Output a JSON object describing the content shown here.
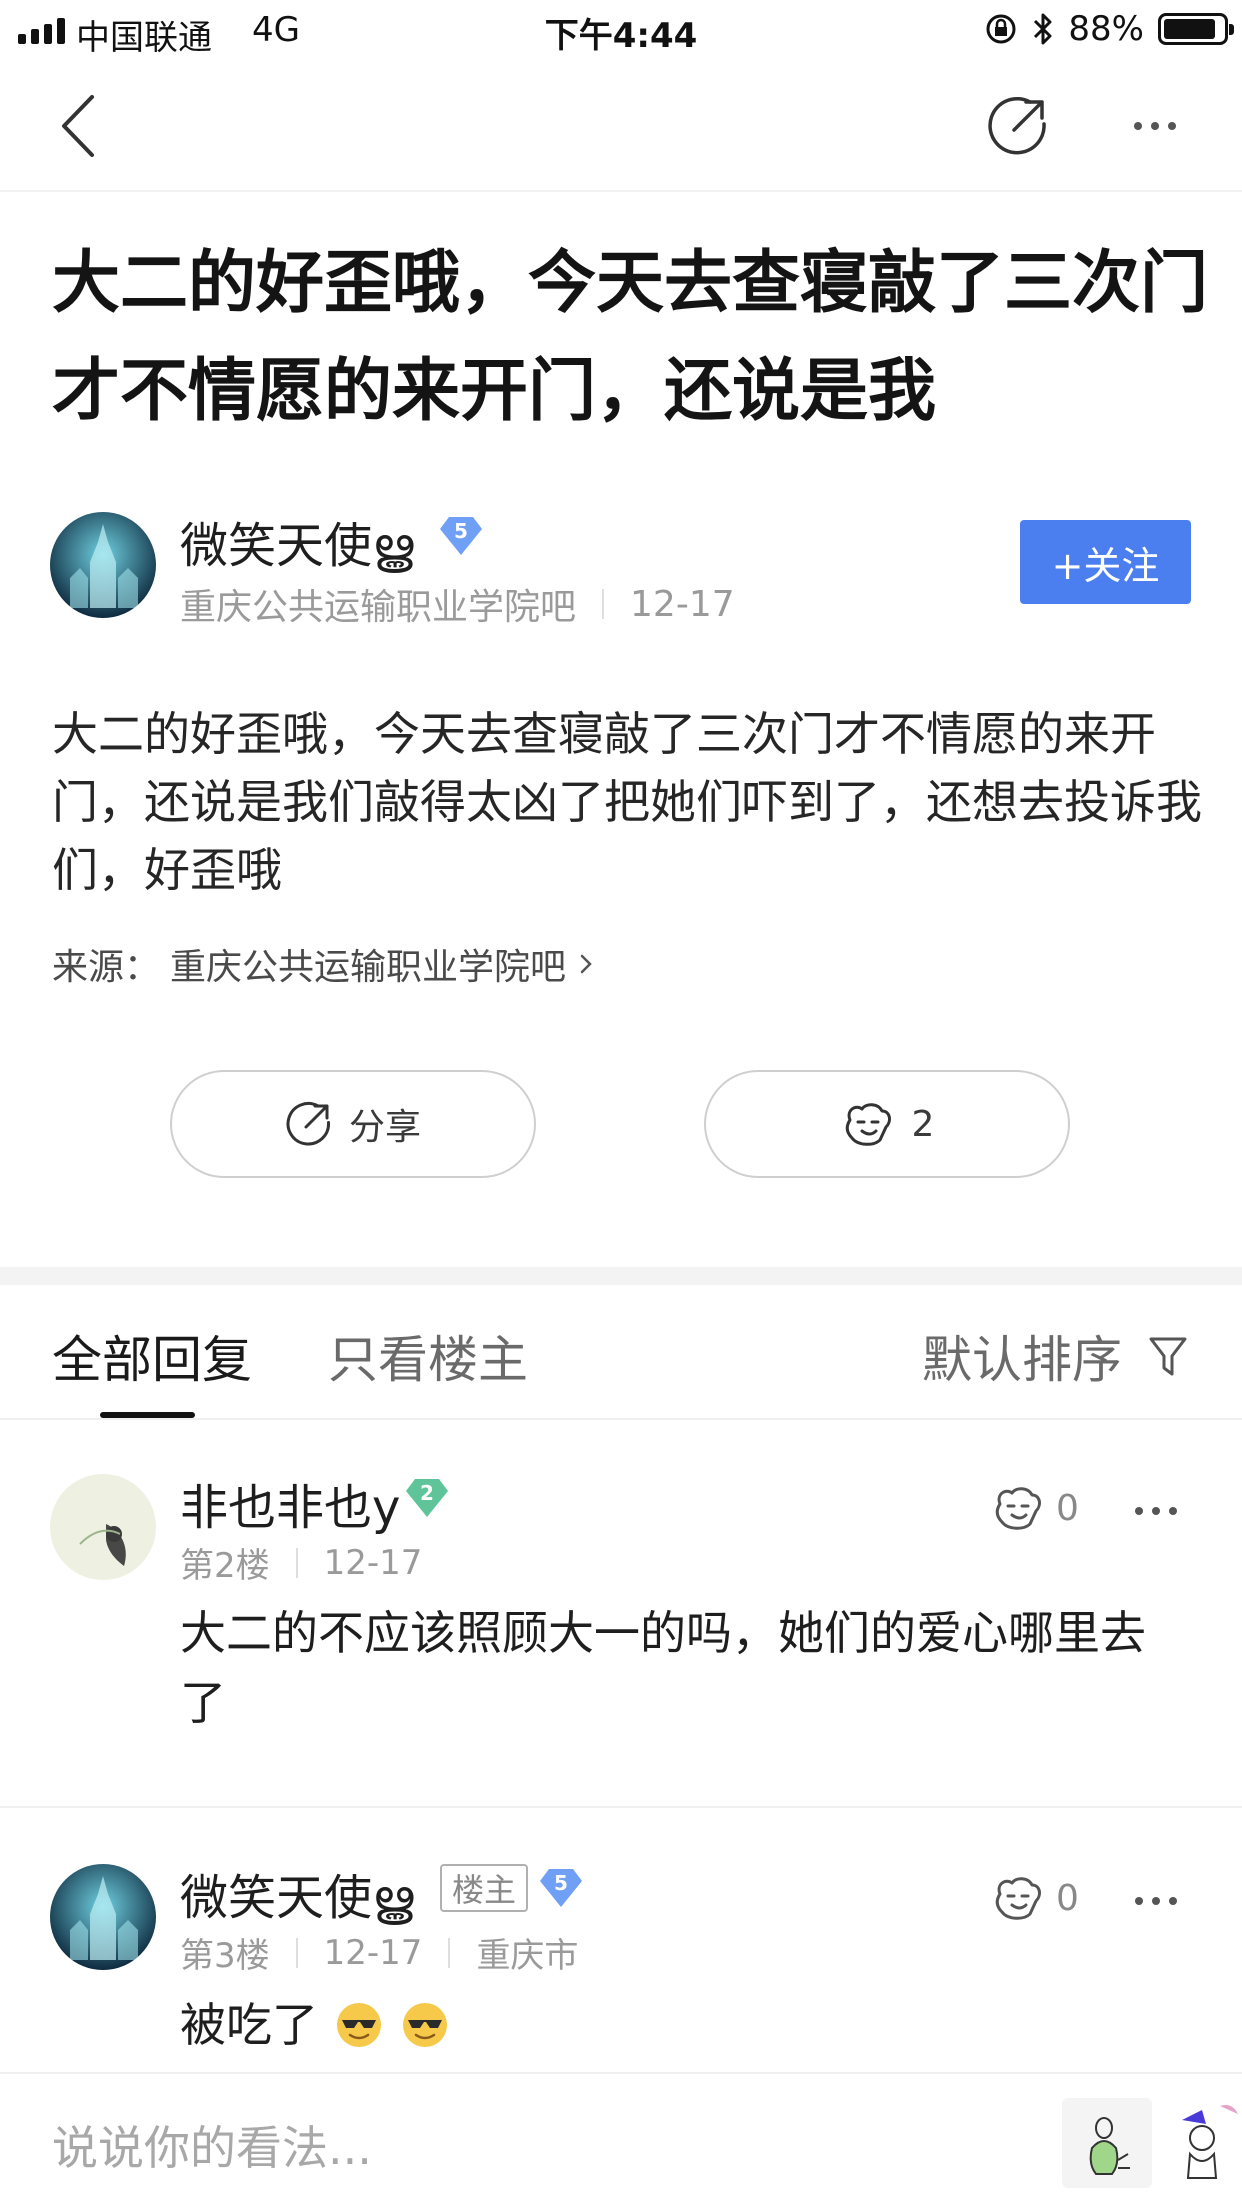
{
  "status_bar": {
    "carrier": "中国联通",
    "network": "4G",
    "time": "下午4:44",
    "battery": "88%"
  },
  "post": {
    "title": "大二的好歪哦，今天去查寝敲了三次门才不情愿的来开门，还说是我",
    "author": {
      "name": "微笑天使ൠ",
      "level": "5",
      "forum": "重庆公共运输职业学院吧",
      "date": "12-17"
    },
    "follow_label": "+关注",
    "body": "大二的好歪哦，今天去查寝敲了三次门才不情愿的来开门，还说是我们敲得太凶了把她们吓到了，还想去投诉我们，好歪哦",
    "source_label": "来源：",
    "source_forum": "重庆公共运输职业学院吧",
    "share_label": "分享",
    "like_count": "2"
  },
  "tabs": {
    "all_replies": "全部回复",
    "owner_only": "只看楼主",
    "sort": "默认排序"
  },
  "replies": [
    {
      "name": "非也非也y",
      "level": "2",
      "floor": "第2楼",
      "date": "12-17",
      "likes": "0",
      "text": "大二的不应该照顾大一的吗，她们的爱心哪里去了"
    },
    {
      "name": "微笑天使ൠ",
      "owner_tag": "楼主",
      "level": "5",
      "floor": "第3楼",
      "date": "12-17",
      "location": "重庆市",
      "likes": "0",
      "text": "被吃了"
    }
  ],
  "composer": {
    "placeholder": "说说你的看法..."
  },
  "colors": {
    "accent": "#4b7ff0",
    "level_blue": "#6fa0f5",
    "level_green": "#5fc49a"
  },
  "icons": [
    "back-icon",
    "share-icon",
    "more-icon",
    "chevron-right-icon",
    "like-hand-icon",
    "filter-icon",
    "emoji-cool-icon"
  ]
}
